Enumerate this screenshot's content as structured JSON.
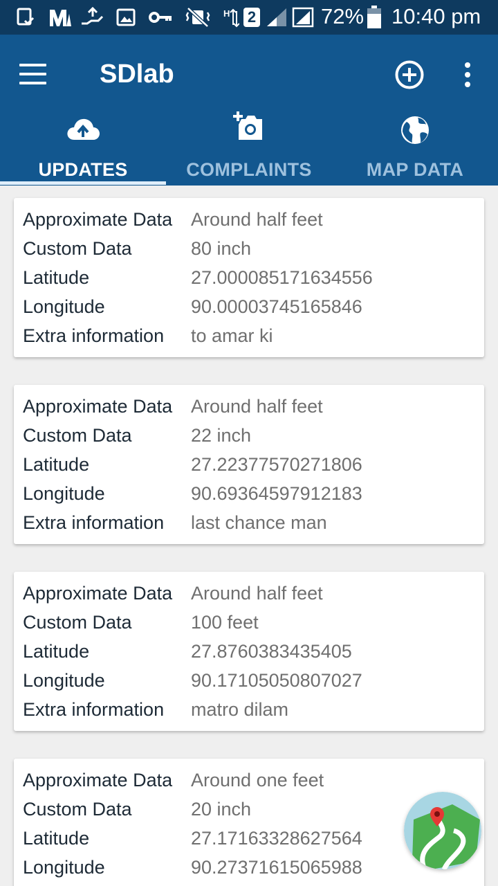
{
  "status_bar": {
    "battery": "72%",
    "time": "10:40 pm",
    "sim_badge": "2"
  },
  "app": {
    "title": "SDlab"
  },
  "tabs": [
    {
      "label": "UPDATES",
      "icon": "cloud-upload-icon",
      "active": true
    },
    {
      "label": "COMPLAINTS",
      "icon": "add-photo-icon",
      "active": false
    },
    {
      "label": "MAP DATA",
      "icon": "globe-icon",
      "active": false
    }
  ],
  "colors": {
    "status_bar": "#0e3a5f",
    "app_bar": "#12578f",
    "background": "#efefef"
  },
  "field_labels": {
    "approx": "Approximate Data",
    "custom": "Custom Data",
    "lat": "Latitude",
    "lng": "Longitude",
    "extra": "Extra information"
  },
  "records": [
    {
      "approx": "Around half feet",
      "custom": "80 inch",
      "lat": "27.000085171634556",
      "lng": "90.00003745165846",
      "extra": "to amar ki"
    },
    {
      "approx": "Around half feet",
      "custom": "22 inch",
      "lat": "27.22377570271806",
      "lng": "90.69364597912183",
      "extra": "last chance man"
    },
    {
      "approx": "Around half feet",
      "custom": "100 feet",
      "lat": "27.8760383435405",
      "lng": "90.17105050807027",
      "extra": "matro dilam"
    },
    {
      "approx": "Around one feet",
      "custom": "20 inch",
      "lat": "27.17163328627564",
      "lng": "90.27371615065988",
      "extra": ""
    }
  ],
  "fab": {
    "icon": "map-pin-icon"
  }
}
